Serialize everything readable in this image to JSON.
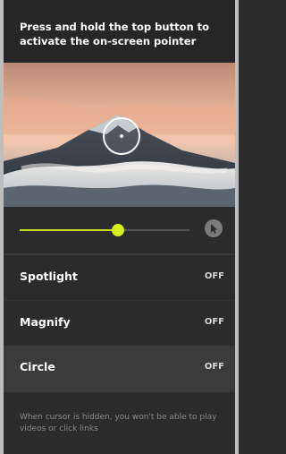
{
  "header": {
    "instruction": "Press and hold the top button to activate the on-screen pointer"
  },
  "preview": {
    "image": "mountain-peak-sunset",
    "cursor": "circle-pointer-icon"
  },
  "slider": {
    "value_fraction": 0.58,
    "track_color": "#555555",
    "fill_color": "#c6dd1a",
    "button_icon": "pointer-icon"
  },
  "menu": {
    "items": [
      {
        "label": "Spotlight",
        "state": "OFF"
      },
      {
        "label": "Magnify",
        "state": "OFF"
      },
      {
        "label": "Circle",
        "state": "OFF"
      }
    ]
  },
  "footer": {
    "note": "When cursor is hidden, you won't be able to play videos or click links"
  }
}
